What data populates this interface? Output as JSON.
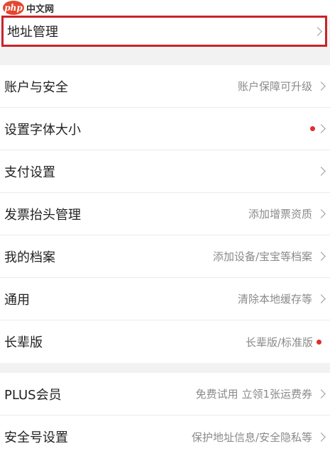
{
  "watermark": {
    "logo": "php",
    "text": "中文网"
  },
  "colors": {
    "highlight_border": "#c8232a",
    "badge_dot": "#e02d2d",
    "page_bg": "#f2f2f2"
  },
  "address": {
    "label": "地址管理"
  },
  "settings_group": [
    {
      "label": "账户与安全",
      "value": "账户保障可升级"
    },
    {
      "label": "设置字体大小",
      "value": ""
    },
    {
      "label": "支付设置",
      "value": ""
    },
    {
      "label": "发票抬头管理",
      "value": "添加增票资质"
    },
    {
      "label": "我的档案",
      "value": "添加设备/宝宝等档案"
    },
    {
      "label": "通用",
      "value": "清除本地缓存等"
    },
    {
      "label": "长辈版",
      "value": "长辈版/标准版"
    }
  ],
  "membership_group": [
    {
      "label": "PLUS会员",
      "value": "免费试用 立领1张运费券"
    },
    {
      "label": "安全号设置",
      "value": "保护地址信息/安全隐私等"
    }
  ]
}
